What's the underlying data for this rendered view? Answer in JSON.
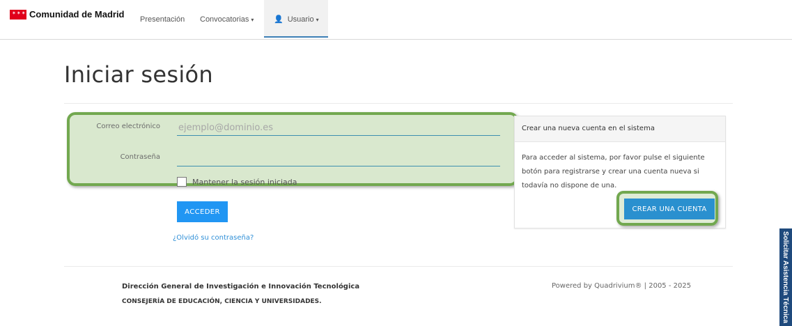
{
  "navbar": {
    "brand": "Comunidad de Madrid",
    "items": [
      {
        "label": "Presentación"
      },
      {
        "label": "Convocatorias"
      },
      {
        "label": "Usuario"
      }
    ]
  },
  "page": {
    "title": "Iniciar sesión"
  },
  "login_form": {
    "email_label": "Correo electrónico",
    "email_placeholder": "ejemplo@dominio.es",
    "email_value": "",
    "password_label": "Contraseña",
    "password_value": "",
    "remember_label": "Mantener la sesión iniciada",
    "remember_checked": false,
    "submit_label": "ACCEDER",
    "forgot_link": "¿Olvidó su contraseña?"
  },
  "register_panel": {
    "header": "Crear una nueva cuenta en el sistema",
    "body": "Para acceder al sistema, por favor pulse el siguiente botón para registrarse y crear una cuenta nueva si todavía no dispone de una.",
    "button_label": "CREAR UNA CUENTA"
  },
  "footer": {
    "org_line1": "Dirección General de Investigación e Innovación Tecnológica",
    "org_line2": "CONSEJERÍA DE EDUCACIÓN, CIENCIA Y UNIVERSIDADES.",
    "powered": "Powered by Quadrivium® | 2005 - 2025"
  },
  "side_tab": {
    "label": "Solicitar Asistencia Técnica"
  },
  "colors": {
    "brand_red": "#e0001a",
    "primary_blue": "#2196f3",
    "highlight_green": "#72a84f",
    "side_tab_blue": "#1f4a7d"
  }
}
